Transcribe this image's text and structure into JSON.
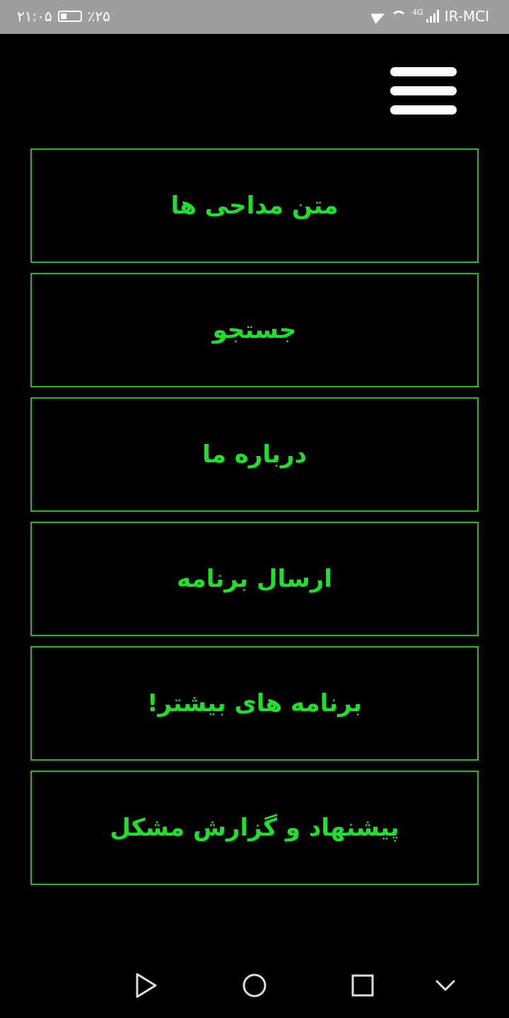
{
  "status_bar": {
    "time": "۲۱:۰۵",
    "battery_percent": "٪۲۵",
    "carrier": "IR-MCI",
    "network_type": "4G"
  },
  "menu": {
    "items": [
      {
        "label": "متن مداحی ها"
      },
      {
        "label": "جستجو"
      },
      {
        "label": "درباره ما"
      },
      {
        "label": "ارسال برنامه"
      },
      {
        "label": "برنامه های بیشتر!"
      },
      {
        "label": "پیشنهاد و گزارش مشکل"
      }
    ]
  },
  "icons": {
    "menu": "hamburger-icon",
    "back": "triangle-back-icon",
    "home": "circle-home-icon",
    "recent": "square-recent-icon",
    "hide": "chevron-down-icon"
  },
  "colors": {
    "background": "#000000",
    "accent_text": "#1fe02a",
    "accent_border": "#22b82a",
    "status_bar": "#9e9e9e"
  }
}
